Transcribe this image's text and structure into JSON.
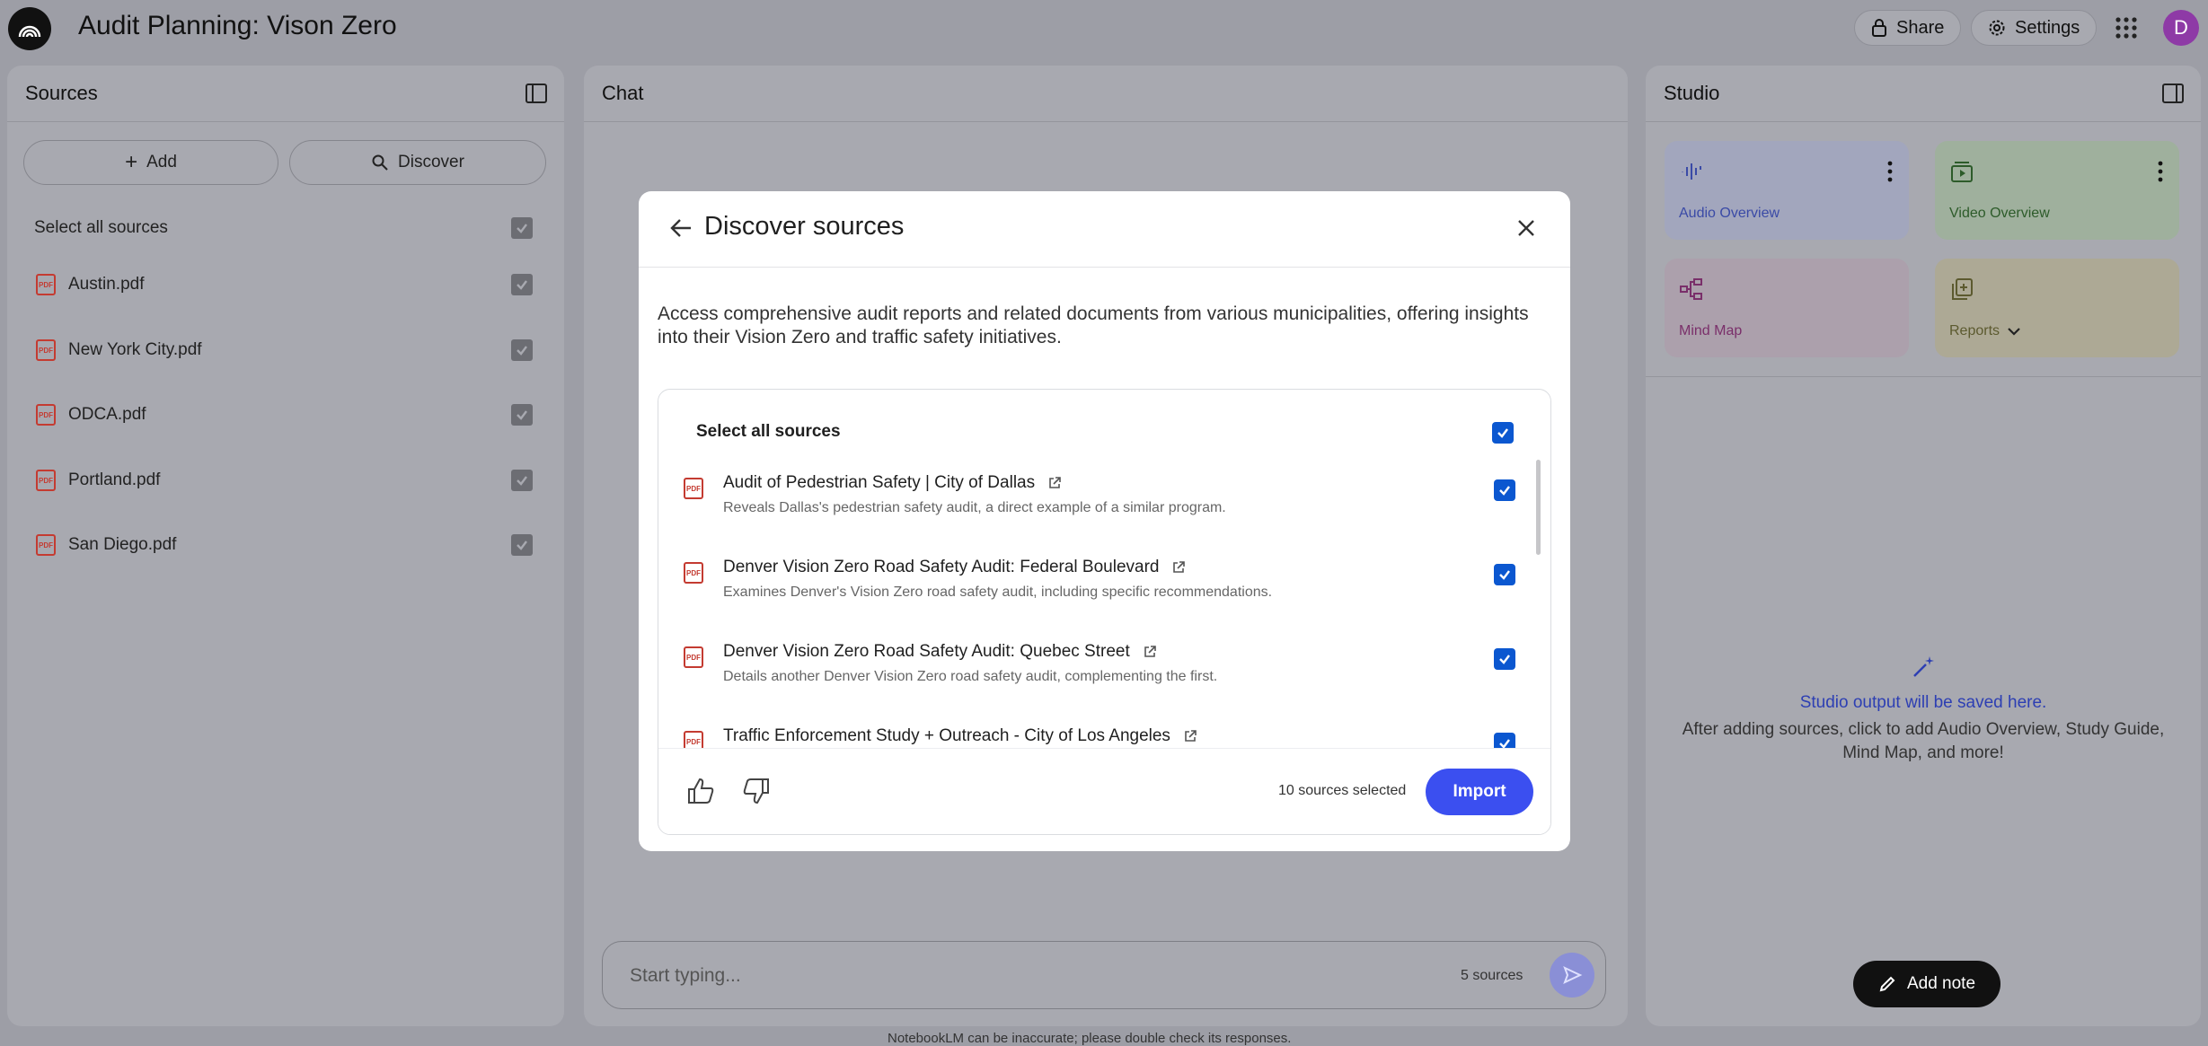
{
  "app": {
    "title": "Audit Planning: Vison Zero",
    "avatar_initial": "D"
  },
  "header": {
    "share_label": "Share",
    "settings_label": "Settings"
  },
  "sources_panel": {
    "title": "Sources",
    "add_label": "Add",
    "discover_label": "Discover",
    "select_all_label": "Select all sources",
    "items": [
      {
        "label": "Austin.pdf"
      },
      {
        "label": "New York City.pdf"
      },
      {
        "label": "ODCA.pdf"
      },
      {
        "label": "Portland.pdf"
      },
      {
        "label": "San Diego.pdf"
      }
    ]
  },
  "chat_panel": {
    "title": "Chat",
    "placeholder": "Start typing...",
    "source_count": "5 sources",
    "disclaimer": "NotebookLM can be inaccurate; please double check its responses."
  },
  "studio_panel": {
    "title": "Studio",
    "cards": [
      {
        "label": "Audio Overview",
        "color": "#3a4aa6"
      },
      {
        "label": "Video Overview",
        "color": "#2d5b2a"
      },
      {
        "label": "Mind Map",
        "color": "#7a2f6a"
      },
      {
        "label": "Reports",
        "color": "#5c5a2f"
      }
    ],
    "empty_title": "Studio output will be saved here.",
    "empty_desc": "After adding sources, click to add Audio Overview, Study Guide, Mind Map, and more!",
    "add_note_label": "Add note"
  },
  "modal": {
    "title": "Discover sources",
    "description": "Access comprehensive audit reports and related documents from various municipalities, offering insights into their Vision Zero and traffic safety initiatives.",
    "select_all_label": "Select all sources",
    "results": [
      {
        "title": "Audit of Pedestrian Safety | City of Dallas",
        "desc": "Reveals Dallas's pedestrian safety audit, a direct example of a similar program."
      },
      {
        "title": "Denver Vision Zero Road Safety Audit: Federal Boulevard",
        "desc": "Examines Denver's Vision Zero road safety audit, including specific recommendations."
      },
      {
        "title": "Denver Vision Zero Road Safety Audit: Quebec Street",
        "desc": "Details another Denver Vision Zero road safety audit, complementing the first."
      },
      {
        "title": "Traffic Enforcement Study + Outreach - City of Los Angeles",
        "desc": ""
      }
    ],
    "selected_count": "10 sources selected",
    "import_label": "Import"
  },
  "colors": {
    "accent": "#0b57d0",
    "import": "#3b4ff0",
    "pdf": "#c43b31",
    "overlay": "#9d9ea6"
  }
}
